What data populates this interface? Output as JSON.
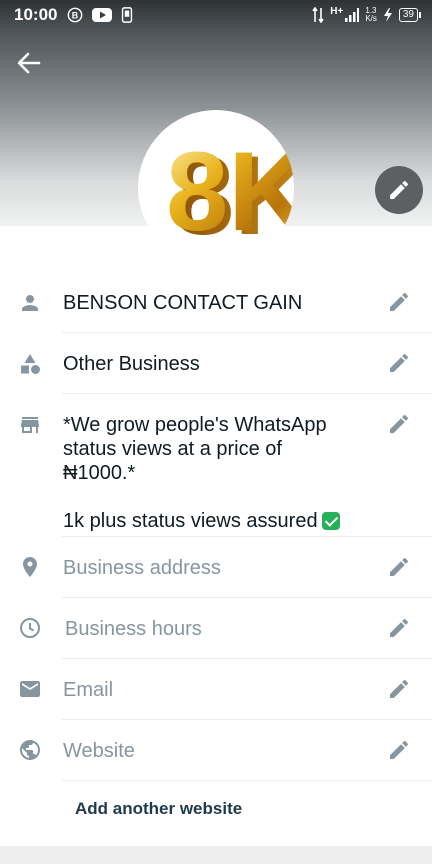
{
  "status_bar": {
    "time": "10:00",
    "network": "H+",
    "speed_value": "1.3",
    "speed_unit": "K/s",
    "battery": "39"
  },
  "header": {
    "avatar_text": "8K"
  },
  "fields": {
    "name": "BENSON CONTACT GAIN",
    "category": "Other Business",
    "description_line1": "*We grow people's WhatsApp",
    "description_line2": "status views at a price of",
    "description_line3": "₦1000.*",
    "description_line4": "1k plus status views assured",
    "address_placeholder": "Business address",
    "hours_placeholder": "Business hours",
    "email_placeholder": "Email",
    "website_placeholder": "Website"
  },
  "add_website_label": "Add another website",
  "colors": {
    "icon": "#8696a0",
    "pencil": "#8696a0",
    "text": "#111b21",
    "link": "#1f3a4c"
  }
}
